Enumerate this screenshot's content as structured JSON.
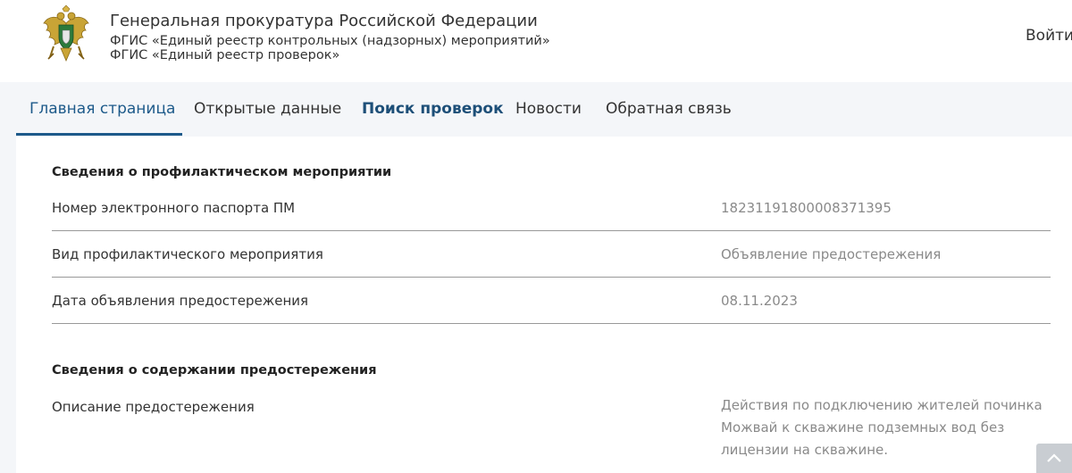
{
  "header": {
    "title": "Генеральная прокуратура Российской Федерации",
    "subtitle_1": "ФГИС «Единый реестр контрольных (надзорных) мероприятий»",
    "subtitle_2": "ФГИС «Единый реестр проверок»",
    "login_label": "Войти"
  },
  "nav": {
    "items": [
      {
        "label": "Главная страница"
      },
      {
        "label": "Открытые данные"
      },
      {
        "label": "Поиск проверок"
      },
      {
        "label": "Новости"
      },
      {
        "label": "Обратная связь"
      }
    ]
  },
  "section_1": {
    "title": "Сведения о профилактическом мероприятии",
    "rows": [
      {
        "label": "Номер электронного паспорта ПМ",
        "value": "18231191800008371395"
      },
      {
        "label": "Вид профилактического мероприятия",
        "value": "Объявление предостережения"
      },
      {
        "label": "Дата объявления предостережения",
        "value": "08.11.2023"
      }
    ]
  },
  "section_2": {
    "title": "Сведения о содержании предостережения",
    "rows": [
      {
        "label": "Описание предостережения",
        "value": "Действия по подключению жителей починка Можвай к скважине подземных вод без лицензии на скважине."
      }
    ]
  },
  "colors": {
    "accent": "#1d5a8a",
    "nav_background": "#f4f6f9",
    "value_text": "#8a8a8a",
    "divider": "#999999"
  },
  "icons": {
    "emblem": "prosecutor-emblem-icon",
    "scroll": "chevron-up-icon"
  }
}
